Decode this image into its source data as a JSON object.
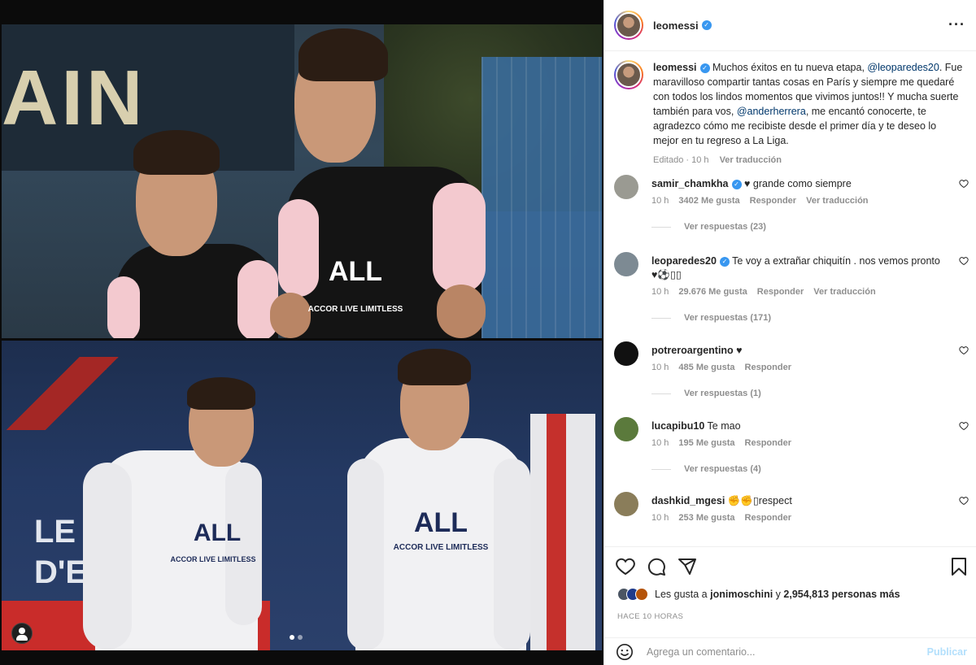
{
  "post": {
    "author": "leomessi",
    "caption": {
      "username": "leomessi",
      "part1": " Muchos éxitos en tu nueva etapa, ",
      "mention1": "@leoparedes20",
      "part2": ". Fue maravilloso compartir tantas cosas en París y siempre me quedaré con todos los lindos momentos que vivimos juntos!! Y mucha suerte también para vos, ",
      "mention2": "@anderherrera",
      "part3": ", me encantó conocerte, te agradezco cómo me recibiste desde el primer día y te deseo lo mejor en tu regreso a La Liga.",
      "edited": "Editado · 10 h",
      "translate": "Ver traducción"
    }
  },
  "comments": [
    {
      "username": "samir_chamkha",
      "verified": true,
      "text": " ♥ grande como siempre",
      "time": "10 h",
      "likes": "3402 Me gusta",
      "reply": "Responder",
      "translate": "Ver traducción",
      "replies": "Ver respuestas (23)",
      "avatar_color": "#9a9a92"
    },
    {
      "username": "leoparedes20",
      "verified": true,
      "text": " Te voy a extrañar chiquitín . nos vemos pronto ♥⚽▯▯",
      "time": "10 h",
      "likes": "29.676 Me gusta",
      "reply": "Responder",
      "translate": "Ver traducción",
      "replies": "Ver respuestas (171)",
      "avatar_color": "#7d8a93"
    },
    {
      "username": "potreroargentino",
      "verified": false,
      "text": " ♥",
      "time": "10 h",
      "likes": "485 Me gusta",
      "reply": "Responder",
      "translate": "",
      "replies": "Ver respuestas (1)",
      "avatar_color": "#111111"
    },
    {
      "username": "lucapibu10",
      "verified": false,
      "text": " Te mao",
      "time": "10 h",
      "likes": "195 Me gusta",
      "reply": "Responder",
      "translate": "",
      "replies": "Ver respuestas (4)",
      "avatar_color": "#5b7a3c"
    },
    {
      "username": "dashkid_mgesi",
      "verified": false,
      "text": " ✊✊▯respect",
      "time": "10 h",
      "likes": "253 Me gusta",
      "reply": "Responder",
      "translate": "",
      "replies": "",
      "avatar_color": "#8a7d5a"
    }
  ],
  "actions": {
    "likes_prefix": "Les gusta a ",
    "likes_user": "jonimoschini",
    "likes_middle": " y ",
    "likes_count": "2,954,813 personas más",
    "time": "HACE 10 HORAS"
  },
  "add_comment": {
    "placeholder": "Agrega un comentario...",
    "publish": "Publicar"
  },
  "media": {
    "wall_text": "AIN",
    "shirt_sponsor": "ALL",
    "shirt_sub": "ACCOR LIVE LIMITLESS",
    "bg_letters": "LE\nD'E    EMENT"
  },
  "colors": {
    "verified": "#3897f0",
    "mention": "#00376b",
    "publish": "#b2dffc"
  }
}
